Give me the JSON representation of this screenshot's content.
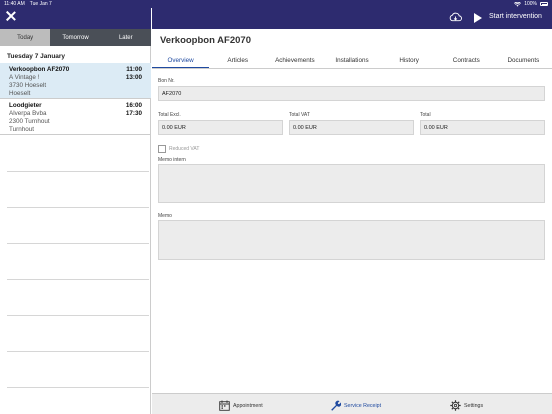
{
  "statusbar": {
    "time": "11:40 AM",
    "date": "Tue Jan 7",
    "battery": "100%"
  },
  "left": {
    "tabs": [
      {
        "label": "Today"
      },
      {
        "label": "Tomorrow"
      },
      {
        "label": "Later"
      }
    ],
    "day_heading": "Tuesday 7 January",
    "appointments": [
      {
        "title": "Verkoopbon AF2070",
        "line1": "A Vintage !",
        "line2": "3730 Hoeselt",
        "line3": "Hoeselt",
        "start": "11:00",
        "end": "13:00"
      },
      {
        "title": "Loodgieter",
        "line1": "Alverpa Bvba",
        "line2": "2300 Turnhout",
        "line3": "Turnhout",
        "start": "16:00",
        "end": "17:30"
      }
    ]
  },
  "header": {
    "start_label": "Start intervention"
  },
  "main": {
    "title": "Verkoopbon AF2070",
    "tabs": [
      {
        "label": "Overview"
      },
      {
        "label": "Articles"
      },
      {
        "label": "Achievements"
      },
      {
        "label": "Installations"
      },
      {
        "label": "History"
      },
      {
        "label": "Contracts"
      },
      {
        "label": "Documents"
      }
    ],
    "bon_label": "Bon Nr.",
    "bon_value": "AF2070",
    "total_excl_label": "Total Excl.",
    "total_excl_value": "0.00 EUR",
    "total_vat_label": "Total VAT",
    "total_vat_value": "0.00 EUR",
    "total_label": "Total",
    "total_value": "0.00 EUR",
    "reduced_vat_label": "Reduced VAT",
    "memo_intern_label": "Memo intern",
    "memo_label": "Memo"
  },
  "footer": {
    "items": [
      {
        "label": "Appointment"
      },
      {
        "label": "Service Receipt"
      },
      {
        "label": "Settings"
      }
    ]
  },
  "colors": {
    "header": "#2d2b6f",
    "accent": "#1f4aa0",
    "selected_row": "#dcebf5"
  }
}
